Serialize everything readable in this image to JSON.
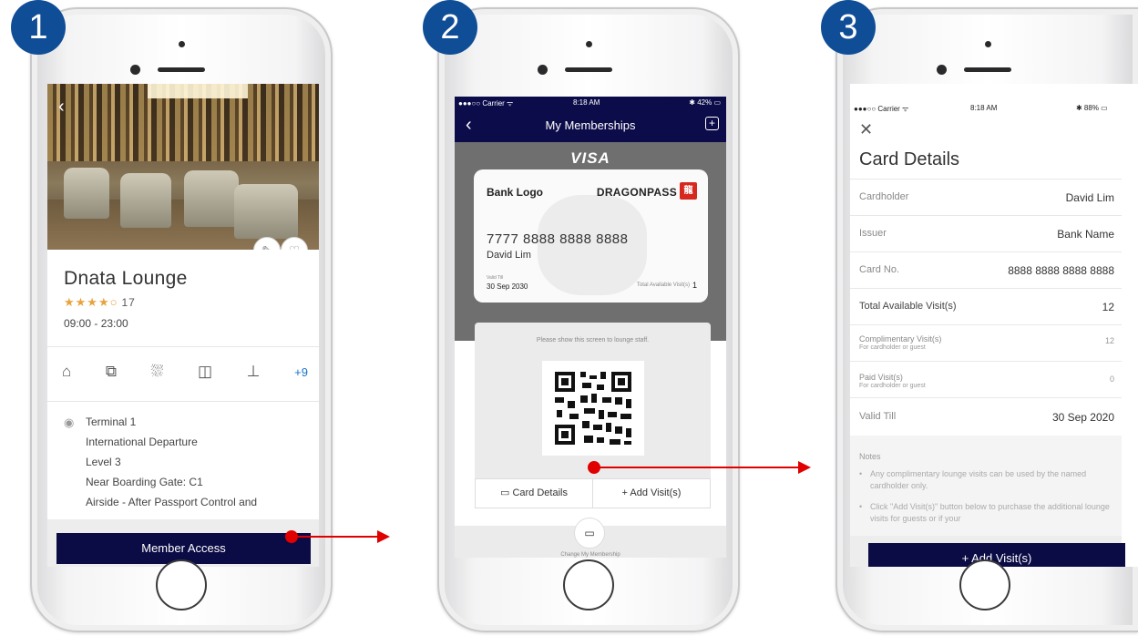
{
  "steps": [
    "1",
    "2",
    "3"
  ],
  "screen1": {
    "lounge_name": "Dnata Lounge",
    "stars": "★★★★○",
    "review_count": "17",
    "hours": "09:00 - 23:00",
    "amenities_icons": [
      "armchair-icon",
      "luggage-icon",
      "shower-icon",
      "wifi-icon",
      "drinks-icon"
    ],
    "amenities_more": "+9",
    "address_lines": [
      "Terminal 1",
      "International Departure",
      "Level 3",
      "Near Boarding Gate: C1",
      "Airside - After Passport Control and"
    ],
    "cta": "Member Access"
  },
  "screen2": {
    "status": {
      "carrier": "●●●○○ Carrier ᯤ",
      "time": "8:18 AM",
      "battery": "✱ 42% ▭"
    },
    "nav_title": "My Memberships",
    "network": "VISA",
    "card": {
      "bank_logo": "Bank Logo",
      "program": "DRAGONPASS",
      "number": "7777 8888 8888 8888",
      "holder": "David Lim",
      "valid_label": "Valid Till",
      "valid_date": "30 Sep 2030",
      "visits_label": "Total Available Visit(s)",
      "visits_value": "1"
    },
    "instruction": "Please show this screen to lounge staff.",
    "actions": {
      "card_details": "Card Details",
      "add_visits": "+ Add Visit(s)"
    },
    "change_label": "Change My Membership"
  },
  "screen3": {
    "status": {
      "carrier": "●●●○○ Carrier ᯤ",
      "time": "8:18 AM",
      "battery": "✱ 88% ▭"
    },
    "title": "Card Details",
    "rows": [
      {
        "label": "Cardholder",
        "value": "David Lim"
      },
      {
        "label": "Issuer",
        "value": "Bank Name"
      },
      {
        "label": "Card No.",
        "value": "8888 8888 8888 8888"
      },
      {
        "label": "Total Available Visit(s)",
        "value": "12"
      }
    ],
    "complimentary": {
      "label": "Complimentary Visit(s)",
      "sub": "For cardholder or guest",
      "value": "12"
    },
    "paid": {
      "label": "Paid Visit(s)",
      "sub": "For cardholder or guest",
      "value": "0"
    },
    "valid": {
      "label": "Valid Till",
      "value": "30 Sep 2020"
    },
    "notes_title": "Notes",
    "notes": [
      "Any complimentary lounge visits can be used by the named cardholder only.",
      "Click \"Add Visit(s)\" button below to purchase the additional lounge visits for guests or if your"
    ],
    "cta": "+ Add Visit(s)"
  },
  "colors": {
    "navy": "#0b0b45",
    "badge": "#0f4d96",
    "arrow": "#e00000",
    "star": "#e8a33c"
  }
}
